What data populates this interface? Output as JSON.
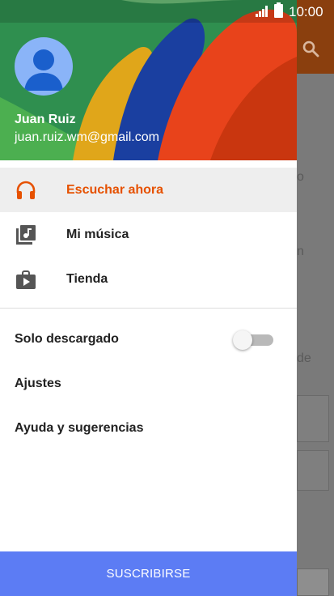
{
  "status_bar": {
    "time": "10:00"
  },
  "account": {
    "name": "Juan Ruiz",
    "email": "juan.ruiz.wm@gmail.com"
  },
  "nav": [
    {
      "label": "Escuchar ahora",
      "icon": "headphones-icon",
      "active": true
    },
    {
      "label": "Mi música",
      "icon": "music-library-icon",
      "active": false
    },
    {
      "label": "Tienda",
      "icon": "store-bag-icon",
      "active": false
    }
  ],
  "settings": {
    "offline_label": "Solo descargado",
    "offline_enabled": false,
    "settings_label": "Ajustes",
    "help_label": "Ayuda y sugerencias"
  },
  "subscribe_label": "SUSCRIBIRSE",
  "background": {
    "partial_text": [
      "o",
      "n",
      "de"
    ]
  },
  "colors": {
    "accent_active": "#e65100",
    "subscribe_button": "#5c7cf4",
    "active_row": "#eeeeee",
    "avatar": "#8ab4f8"
  }
}
